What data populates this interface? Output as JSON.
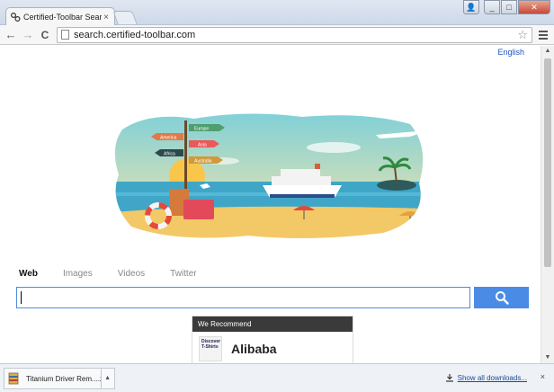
{
  "window": {
    "tab_title": "Certified-Toolbar Search",
    "tab_close": "×",
    "user_glyph": "👤",
    "min_glyph": "_",
    "max_glyph": "□",
    "close_glyph": "✕"
  },
  "toolbar": {
    "back_glyph": "←",
    "forward_glyph": "→",
    "reload_glyph": "C",
    "url": "search.certified-toolbar.com",
    "star_glyph": "☆"
  },
  "page": {
    "language_link": "English",
    "illustration": {
      "signs": [
        "Europe",
        "America",
        "Asia",
        "Africa",
        "Australia"
      ]
    },
    "search_tabs": [
      {
        "label": "Web",
        "active": true
      },
      {
        "label": "Images",
        "active": false
      },
      {
        "label": "Videos",
        "active": false
      },
      {
        "label": "Twitter",
        "active": false
      }
    ],
    "search_value": "",
    "recommend": {
      "header": "We Recommend",
      "thumb_text": "Discover T-Shirts",
      "title": "Alibaba"
    }
  },
  "downloads": {
    "file_name": "Titanium Driver Rem....zip",
    "arrow_glyph": "▲",
    "show_all": "Show all downloads...",
    "close_glyph": "×"
  },
  "colors": {
    "search_button": "#4a8be6",
    "link": "#1a55c0",
    "sea": "#3fa6c8",
    "sand": "#f3c866"
  }
}
